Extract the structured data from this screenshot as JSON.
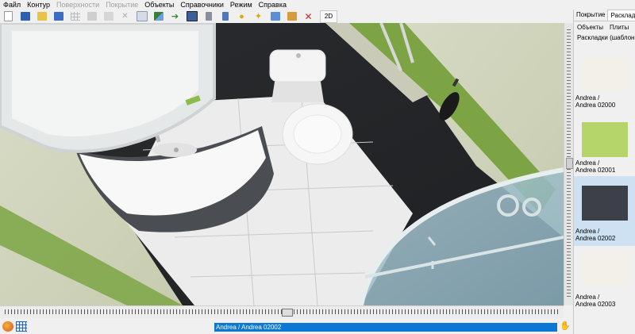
{
  "menu": {
    "items": [
      {
        "label": "Файл",
        "enabled": true
      },
      {
        "label": "Контур",
        "enabled": true
      },
      {
        "label": "Поверхности",
        "enabled": false
      },
      {
        "label": "Покрытие",
        "enabled": false
      },
      {
        "label": "Объекты",
        "enabled": true
      },
      {
        "label": "Справочники",
        "enabled": true
      },
      {
        "label": "Режим",
        "enabled": true
      },
      {
        "label": "Справка",
        "enabled": true
      }
    ]
  },
  "toolbar": {
    "mode_2d_label": "2D",
    "icons": [
      "new-icon",
      "save-icon",
      "open-icon",
      "save-as-icon",
      "grid-icon",
      "copy-icon",
      "paste-icon",
      "cut-icon",
      "catalog-icon",
      "layers-icon",
      "export-icon",
      "render-icon",
      "wall-icon",
      "door-icon",
      "light-icon",
      "light-settings-icon",
      "reflect-icon",
      "texture-icon",
      "delete-icon"
    ]
  },
  "right_panel": {
    "tabs": [
      {
        "label": "Покрытие",
        "active": false
      },
      {
        "label": "Раскладки",
        "active": true
      }
    ],
    "subtabs": [
      {
        "label": "Объекты"
      },
      {
        "label": "Плиты"
      }
    ],
    "layouts_label": "Раскладки (шаблоны)",
    "tiles": [
      {
        "line1": "Andrea /",
        "line2": "Andrea 02000",
        "color": "#f2f0e8",
        "selected": false
      },
      {
        "line1": "Andrea /",
        "line2": "Andrea 02001",
        "color": "#b5d56a",
        "selected": false
      },
      {
        "line1": "Andrea /",
        "line2": "Andrea 02002",
        "color": "#3d4048",
        "selected": true
      },
      {
        "line1": "Andrea /",
        "line2": "Andrea 02003",
        "color": "#f2f0e8",
        "selected": false
      }
    ]
  },
  "status": {
    "selected_item": "Andrea / Andrea 02002"
  },
  "colors": {
    "accent": "#0a78d4",
    "dark_tile": "#2b2d30",
    "green_tile": "#8db654",
    "floor": "#f2f2f2"
  }
}
